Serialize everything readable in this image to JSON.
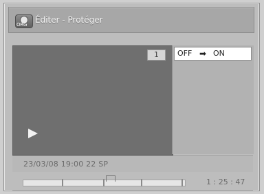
{
  "title": {
    "icon_text": "ORG",
    "text": "Éditer - Protéger"
  },
  "preview": {
    "badge_number": "1",
    "play_icon": "play-icon"
  },
  "protect_setting": {
    "from": "OFF",
    "arrow": "➡",
    "to": "ON"
  },
  "info": {
    "text": "23/03/08  19:00  22  SP"
  },
  "timeline": {
    "time": "1 : 25 : 47"
  }
}
